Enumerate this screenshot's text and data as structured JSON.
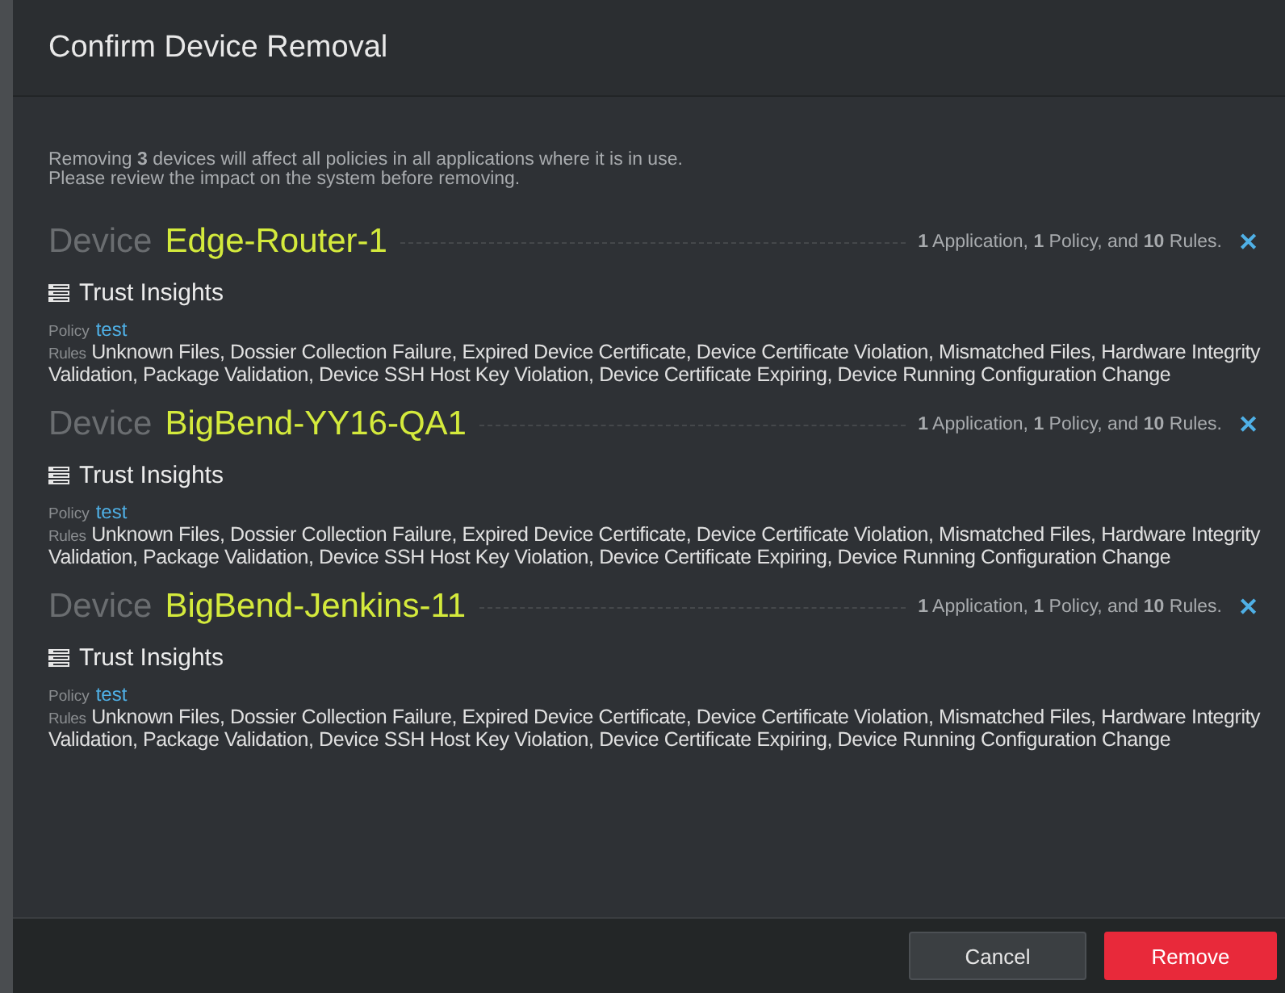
{
  "dialog": {
    "title": "Confirm Device Removal",
    "intro": [
      "Removing **3** devices will affect all policies in all applications where it is in use.",
      "Please review the impact on the system before removing."
    ],
    "devices": [
      {
        "label": "Device",
        "name": "Edge-Router-1",
        "summary": "**1** Application, **1** Policy, and **10** Rules.",
        "remove_icon": "✕",
        "application": "Trust Insights",
        "policy_label": "Policy",
        "policy": "test",
        "rules_label": "Rules",
        "rules": "Unknown Files, Dossier Collection Failure, Expired Device Certificate, Device Certificate Violation, Mismatched Files, Hardware Integrity Validation, Package Validation, Device SSH Host Key Violation, Device Certificate Expiring, Device Running Configuration Change"
      },
      {
        "label": "Device",
        "name": "BigBend-YY16-QA1",
        "summary": "**1** Application, **1** Policy, and **10** Rules.",
        "remove_icon": "✕",
        "application": "Trust Insights",
        "policy_label": "Policy",
        "policy": "test",
        "rules_label": "Rules",
        "rules": "Unknown Files, Dossier Collection Failure, Expired Device Certificate, Device Certificate Violation, Mismatched Files, Hardware Integrity Validation, Package Validation, Device SSH Host Key Violation, Device Certificate Expiring, Device Running Configuration Change"
      },
      {
        "label": "Device",
        "name": "BigBend-Jenkins-11",
        "summary": "**1** Application, **1** Policy, and **10** Rules.",
        "remove_icon": "✕",
        "application": "Trust Insights",
        "policy_label": "Policy",
        "policy": "test",
        "rules_label": "Rules",
        "rules": "Unknown Files, Dossier Collection Failure, Expired Device Certificate, Device Certificate Violation, Mismatched Files, Hardware Integrity Validation, Package Validation, Device SSH Host Key Violation, Device Certificate Expiring, Device Running Configuration Change"
      }
    ],
    "buttons": [
      {
        "label": "Cancel",
        "kind": "secondary"
      },
      {
        "label": "Remove",
        "kind": "danger"
      }
    ]
  }
}
